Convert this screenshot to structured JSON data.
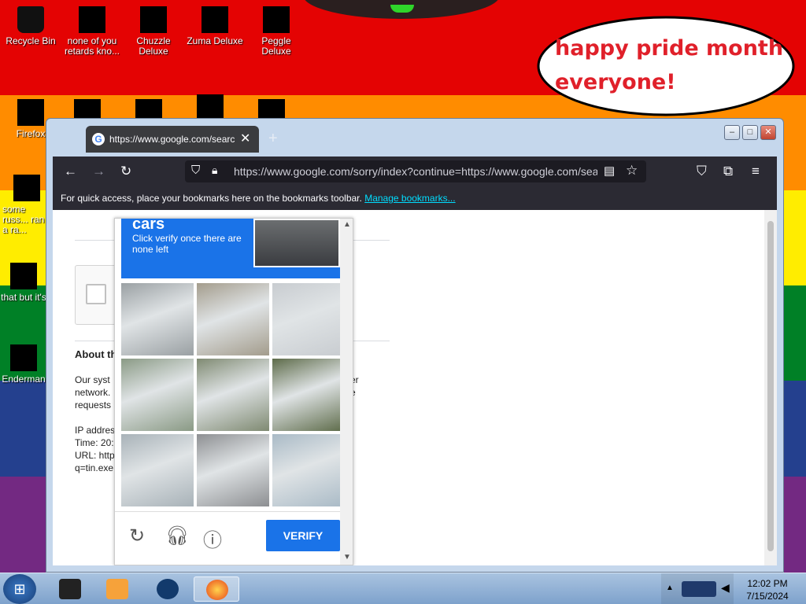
{
  "desktop": {
    "colors": [
      "#e40303",
      "#ff8c00",
      "#ffed00",
      "#008026",
      "#24408e",
      "#732982"
    ],
    "icons": [
      {
        "label": "Recycle Bin"
      },
      {
        "label": "none of you retards kno..."
      },
      {
        "label": "Chuzzle Deluxe"
      },
      {
        "label": "Zuma Deluxe"
      },
      {
        "label": "Peggle Deluxe"
      },
      {
        "label": "Firefox"
      },
      {
        "label": "some russ... ran a ra..."
      },
      {
        "label": "that but it's"
      },
      {
        "label": "Enderman"
      }
    ],
    "bubble_text": "happy pride month everyone!"
  },
  "browser": {
    "tab_title": "https://www.google.com/searc",
    "tab_close": "✕",
    "new_tab": "+",
    "url": "https://www.google.com/sorry/index?continue=https://www.google.com/sea",
    "bookmarks_text": "For quick access, place your bookmarks here on the bookmarks toolbar.",
    "bookmarks_link": "Manage bookmarks...",
    "window_buttons": {
      "minimize": "–",
      "maximize": "□",
      "close": "✕"
    }
  },
  "page": {
    "about_heading": "About th",
    "about_lines": [
      "Our syst",
      "network.",
      "requests"
    ],
    "right_fragments": [
      "er",
      "e"
    ],
    "ip_lines": [
      "IP addres",
      "Time: 20:",
      "URL: http",
      "q=tin.exe"
    ]
  },
  "captcha": {
    "heading": "cars",
    "instruction": "Click verify once there are none left",
    "verify_label": "VERIFY",
    "tiles": [
      {
        "name": "bike-lane"
      },
      {
        "name": "street-motorcycle"
      },
      {
        "name": "traffic-light"
      },
      {
        "name": "trees-road"
      },
      {
        "name": "building-hedge"
      },
      {
        "name": "garden"
      },
      {
        "name": "streetlight"
      },
      {
        "name": "intersection"
      },
      {
        "name": "palm-tree"
      }
    ],
    "tile_colors": [
      "#9aa0a3",
      "#a39c8c",
      "#c8ccd0",
      "#8a9a85",
      "#7f8a72",
      "#5d6b49",
      "#a8b2b8",
      "#8d8f92",
      "#a9bac6"
    ]
  },
  "taskbar": {
    "time": "12:02 PM",
    "date": "7/15/2024"
  }
}
